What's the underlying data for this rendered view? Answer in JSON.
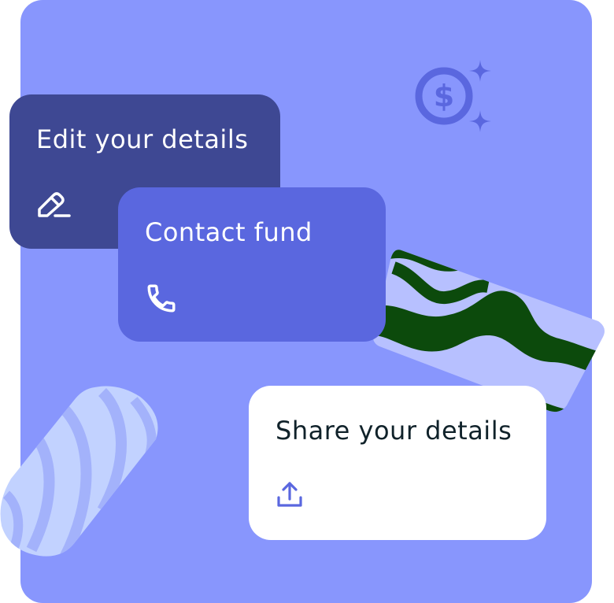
{
  "colors": {
    "panel_background": "#8896fd",
    "edit_card": "#3e4893",
    "contact_card": "#5a67df",
    "share_card": "#ffffff",
    "share_icon": "#5a67df",
    "pattern_dark_green": "#0c4a0c",
    "pattern_light": "#c2ccff"
  },
  "decorations": {
    "dollar_icon": "dollar-sparkle-icon",
    "green_pattern": "zebra-pattern",
    "light_pattern": "stripe-pattern"
  },
  "cards": {
    "edit": {
      "label": "Edit your details",
      "icon": "pencil-icon"
    },
    "contact": {
      "label": "Contact fund",
      "icon": "phone-icon"
    },
    "share": {
      "label": "Share your details",
      "icon": "upload-icon"
    }
  }
}
